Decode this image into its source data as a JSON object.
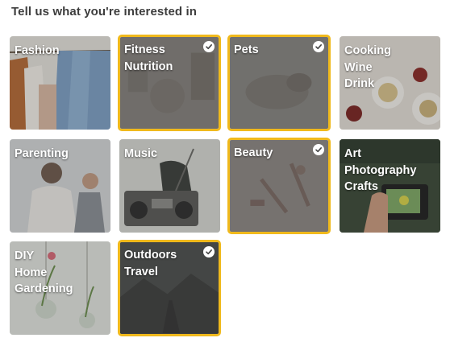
{
  "page": {
    "heading": "Tell us what you're interested in"
  },
  "topics": [
    {
      "id": "fashion",
      "lines": [
        "Fashion"
      ],
      "selected": false,
      "icon": "photo-fashion"
    },
    {
      "id": "fitness-nutrition",
      "lines": [
        "Fitness",
        "Nutrition"
      ],
      "selected": true,
      "icon": "photo-fitness"
    },
    {
      "id": "pets",
      "lines": [
        "Pets"
      ],
      "selected": true,
      "icon": "photo-pets"
    },
    {
      "id": "cooking-wine-drink",
      "lines": [
        "Cooking",
        "Wine",
        "Drink"
      ],
      "selected": false,
      "icon": "photo-cooking"
    },
    {
      "id": "parenting",
      "lines": [
        "Parenting"
      ],
      "selected": false,
      "icon": "photo-parenting"
    },
    {
      "id": "music",
      "lines": [
        "Music"
      ],
      "selected": false,
      "icon": "photo-music"
    },
    {
      "id": "beauty",
      "lines": [
        "Beauty"
      ],
      "selected": true,
      "icon": "photo-beauty"
    },
    {
      "id": "art-photography-crafts",
      "lines": [
        "Art",
        "Photography",
        "Crafts"
      ],
      "selected": false,
      "icon": "photo-art"
    },
    {
      "id": "diy-home-gardening",
      "lines": [
        "DIY",
        "Home",
        "Gardening"
      ],
      "selected": false,
      "icon": "photo-diy"
    },
    {
      "id": "outdoors-travel",
      "lines": [
        "Outdoors",
        "Travel"
      ],
      "selected": true,
      "icon": "photo-outdoors"
    }
  ],
  "colors": {
    "selected_border": "#f0b91c",
    "check_bg": "#ffffff",
    "heading": "#3d3d3d"
  }
}
